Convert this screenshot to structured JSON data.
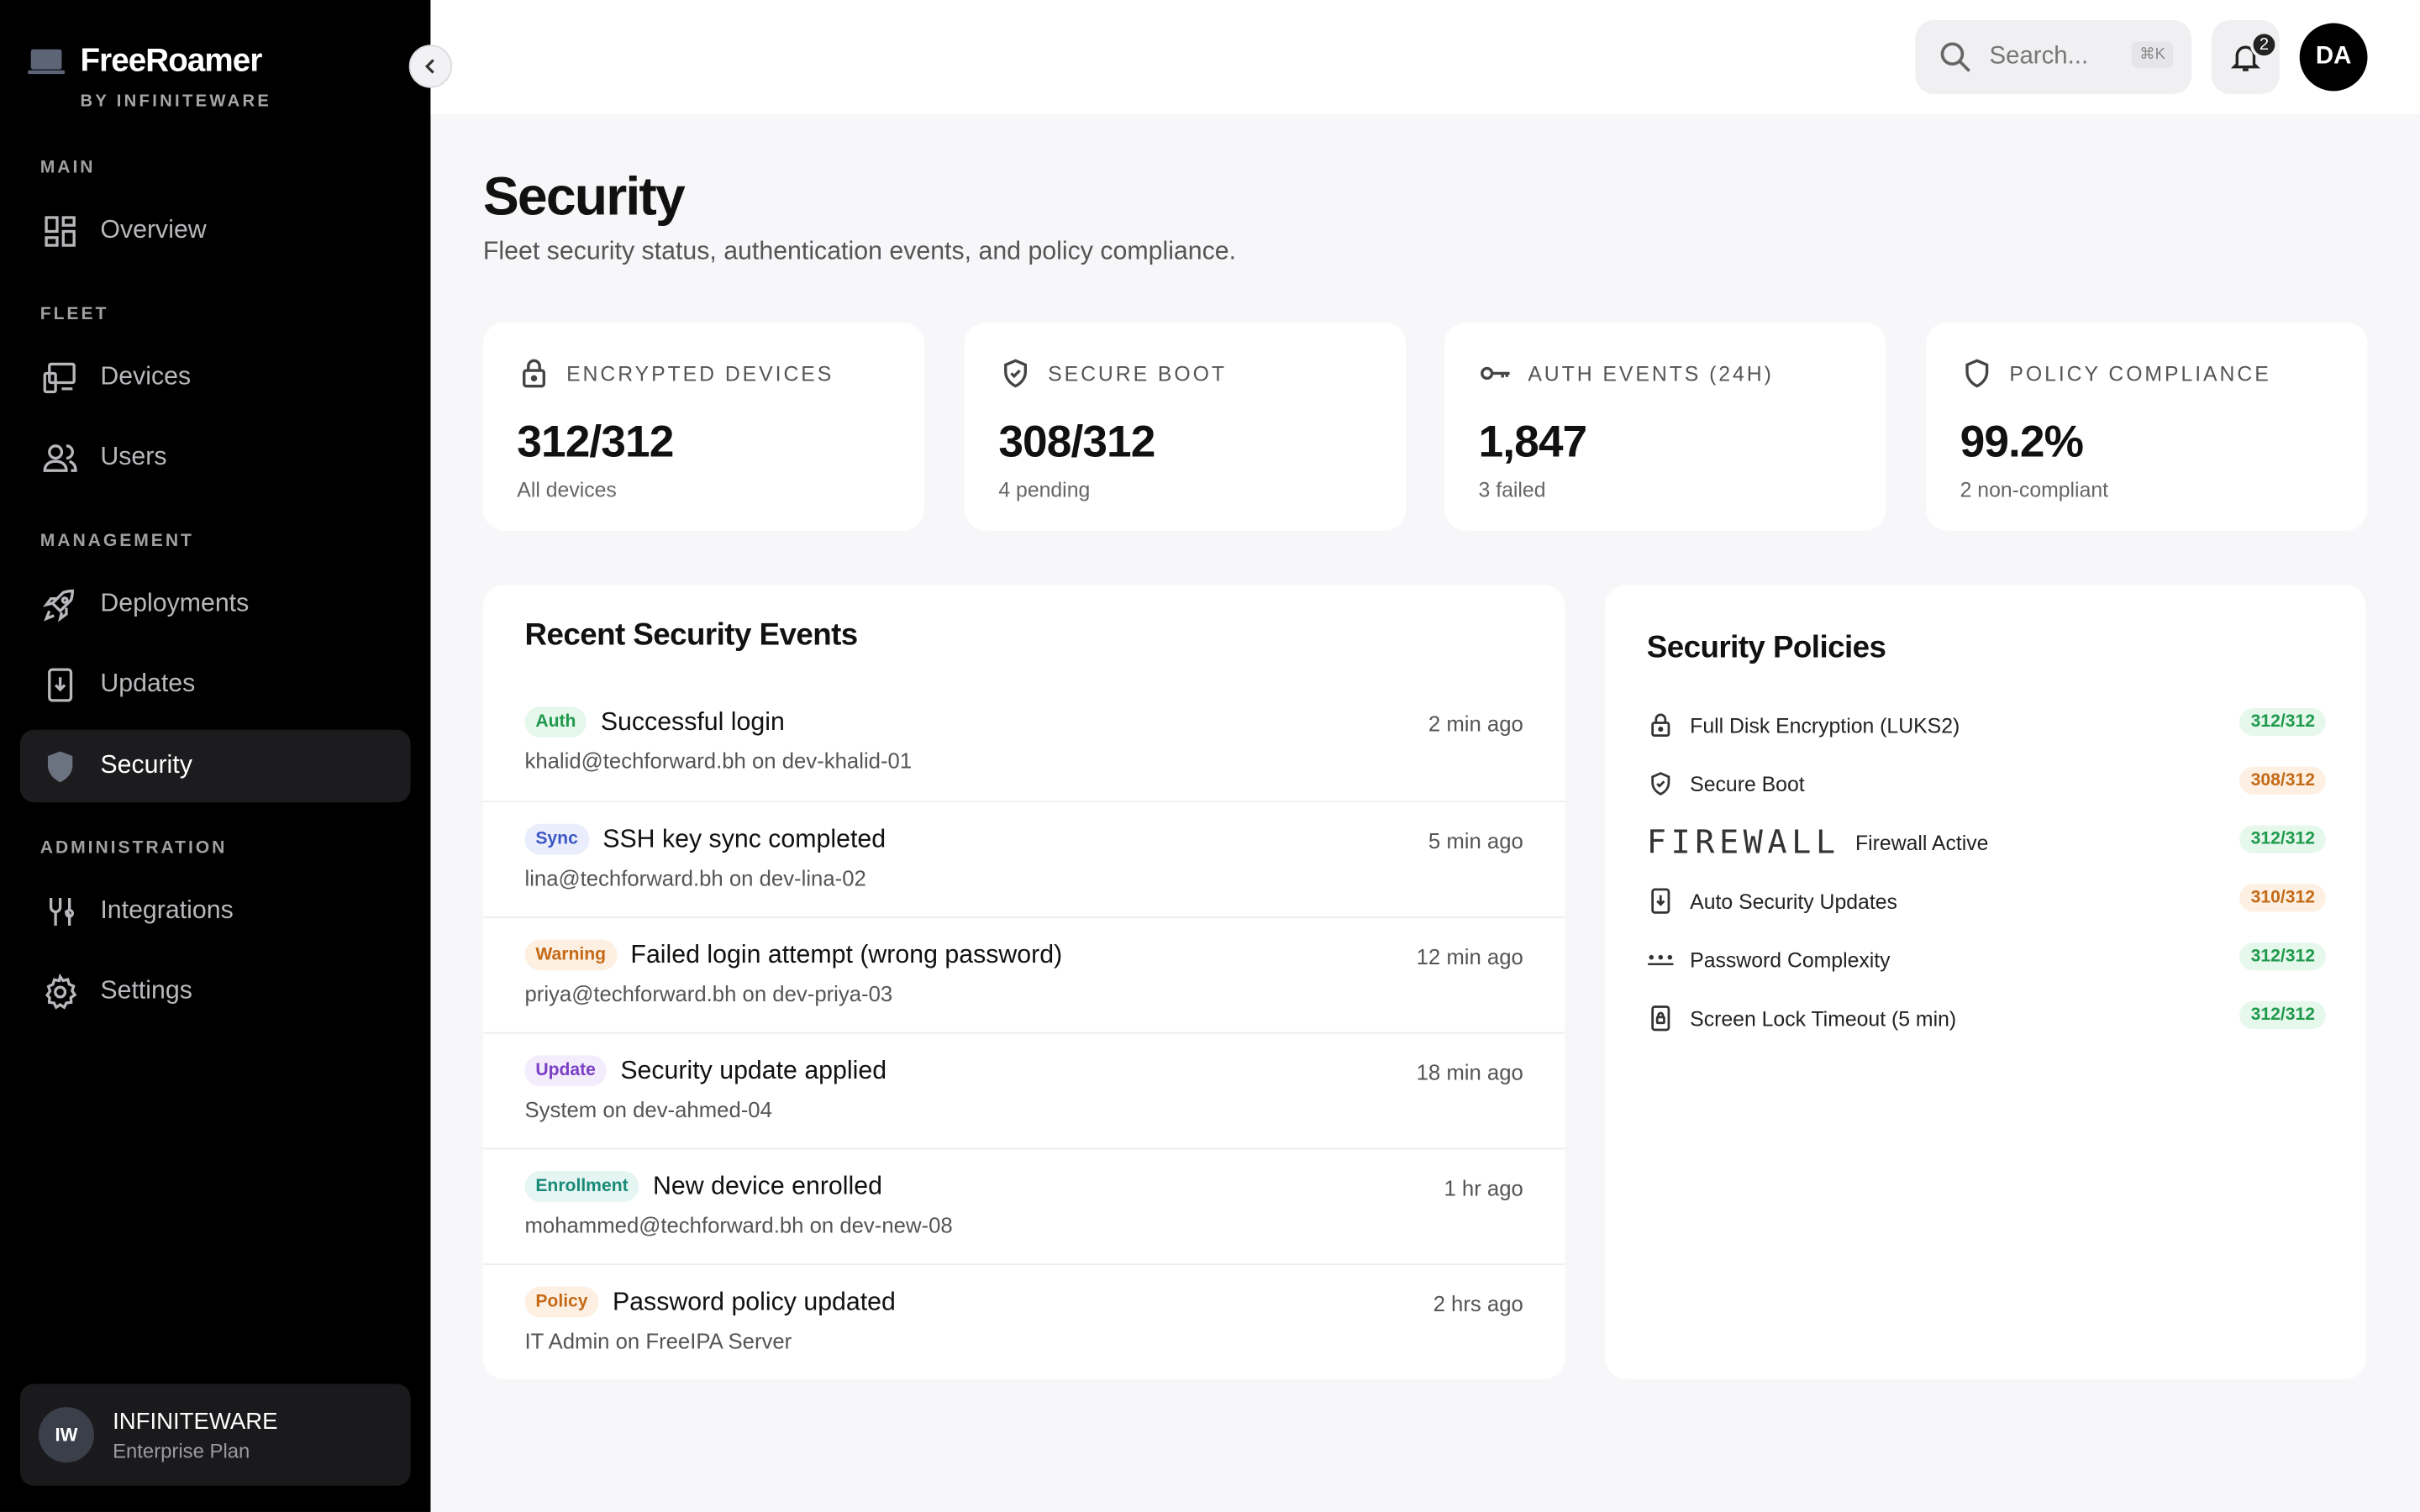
{
  "brand": {
    "name": "FreeRoamer",
    "sub": "BY INFINITEWARE"
  },
  "sidebar": {
    "sections": [
      "MAIN",
      "FLEET",
      "MANAGEMENT",
      "ADMINISTRATION"
    ],
    "items": [
      {
        "label": "Overview",
        "icon": "grid-icon"
      },
      {
        "label": "Devices",
        "icon": "devices-icon"
      },
      {
        "label": "Users",
        "icon": "users-icon"
      },
      {
        "label": "Deployments",
        "icon": "rocket-icon"
      },
      {
        "label": "Updates",
        "icon": "download-device-icon"
      },
      {
        "label": "Security",
        "icon": "shield-icon",
        "active": true
      },
      {
        "label": "Integrations",
        "icon": "integrations-icon"
      },
      {
        "label": "Settings",
        "icon": "gear-icon"
      }
    ],
    "org": {
      "initials": "IW",
      "name": "INFINITEWARE",
      "plan": "Enterprise Plan"
    }
  },
  "header": {
    "search_placeholder": "Search...",
    "shortcut": "⌘K",
    "notifications": "2",
    "user_initials": "DA"
  },
  "page": {
    "title": "Security",
    "subtitle": "Fleet security status, authentication events, and policy compliance."
  },
  "stats": [
    {
      "label": "ENCRYPTED DEVICES",
      "value": "312/312",
      "sub": "All devices",
      "icon": "lock-icon"
    },
    {
      "label": "SECURE BOOT",
      "value": "308/312",
      "sub": "4 pending",
      "icon": "shield-check-icon"
    },
    {
      "label": "AUTH EVENTS (24H)",
      "value": "1,847",
      "sub": "3 failed",
      "icon": "key-icon"
    },
    {
      "label": "POLICY COMPLIANCE",
      "value": "99.2%",
      "sub": "2 non-compliant",
      "icon": "shield-icon"
    }
  ],
  "events": {
    "title": "Recent Security Events",
    "items": [
      {
        "badge": "Auth",
        "title": "Successful login",
        "sub": "khalid@techforward.bh on dev-khalid-01",
        "time": "2 min ago",
        "badge_bg": "#e6f7ec",
        "badge_fg": "#1f9a4c"
      },
      {
        "badge": "Sync",
        "title": "SSH key sync completed",
        "sub": "lina@techforward.bh on dev-lina-02",
        "time": "5 min ago",
        "badge_bg": "#eaeefc",
        "badge_fg": "#3a56c4"
      },
      {
        "badge": "Warning",
        "title": "Failed login attempt (wrong password)",
        "sub": "priya@techforward.bh on dev-priya-03",
        "time": "12 min ago",
        "badge_bg": "#fdf0e3",
        "badge_fg": "#c46a17"
      },
      {
        "badge": "Update",
        "title": "Security update applied",
        "sub": "System on dev-ahmed-04",
        "time": "18 min ago",
        "badge_bg": "#f3ecfc",
        "badge_fg": "#7a3fc4"
      },
      {
        "badge": "Enrollment",
        "title": "New device enrolled",
        "sub": "mohammed@techforward.bh on dev-new-08",
        "time": "1 hr ago",
        "badge_bg": "#e4f5f2",
        "badge_fg": "#1a8a78"
      },
      {
        "badge": "Policy",
        "title": "Password policy updated",
        "sub": "IT Admin on FreeIPA Server",
        "time": "2 hrs ago",
        "badge_bg": "#fdf0e3",
        "badge_fg": "#c46a17"
      }
    ]
  },
  "policies": {
    "title": "Security Policies",
    "items": [
      {
        "label": "Full Disk Encryption (LUKS2)",
        "count": "312/312",
        "icon": "lock-icon",
        "status": "ok"
      },
      {
        "label": "Secure Boot",
        "count": "308/312",
        "icon": "shield-check-icon",
        "status": "warn"
      },
      {
        "label": "Firewall Active",
        "count": "312/312",
        "icon": "firewall-logo",
        "logo_text": "FIREWALL",
        "status": "ok"
      },
      {
        "label": "Auto Security Updates",
        "count": "310/312",
        "icon": "download-device-icon",
        "status": "warn"
      },
      {
        "label": "Password Complexity",
        "count": "312/312",
        "icon": "dots-icon",
        "status": "ok"
      },
      {
        "label": "Screen Lock Timeout (5 min)",
        "count": "312/312",
        "icon": "phone-lock-icon",
        "status": "ok"
      }
    ],
    "colors": {
      "ok_bg": "#e6f7ec",
      "ok_fg": "#1f9a4c",
      "warn_bg": "#fdf0e3",
      "warn_fg": "#c46a17"
    }
  }
}
